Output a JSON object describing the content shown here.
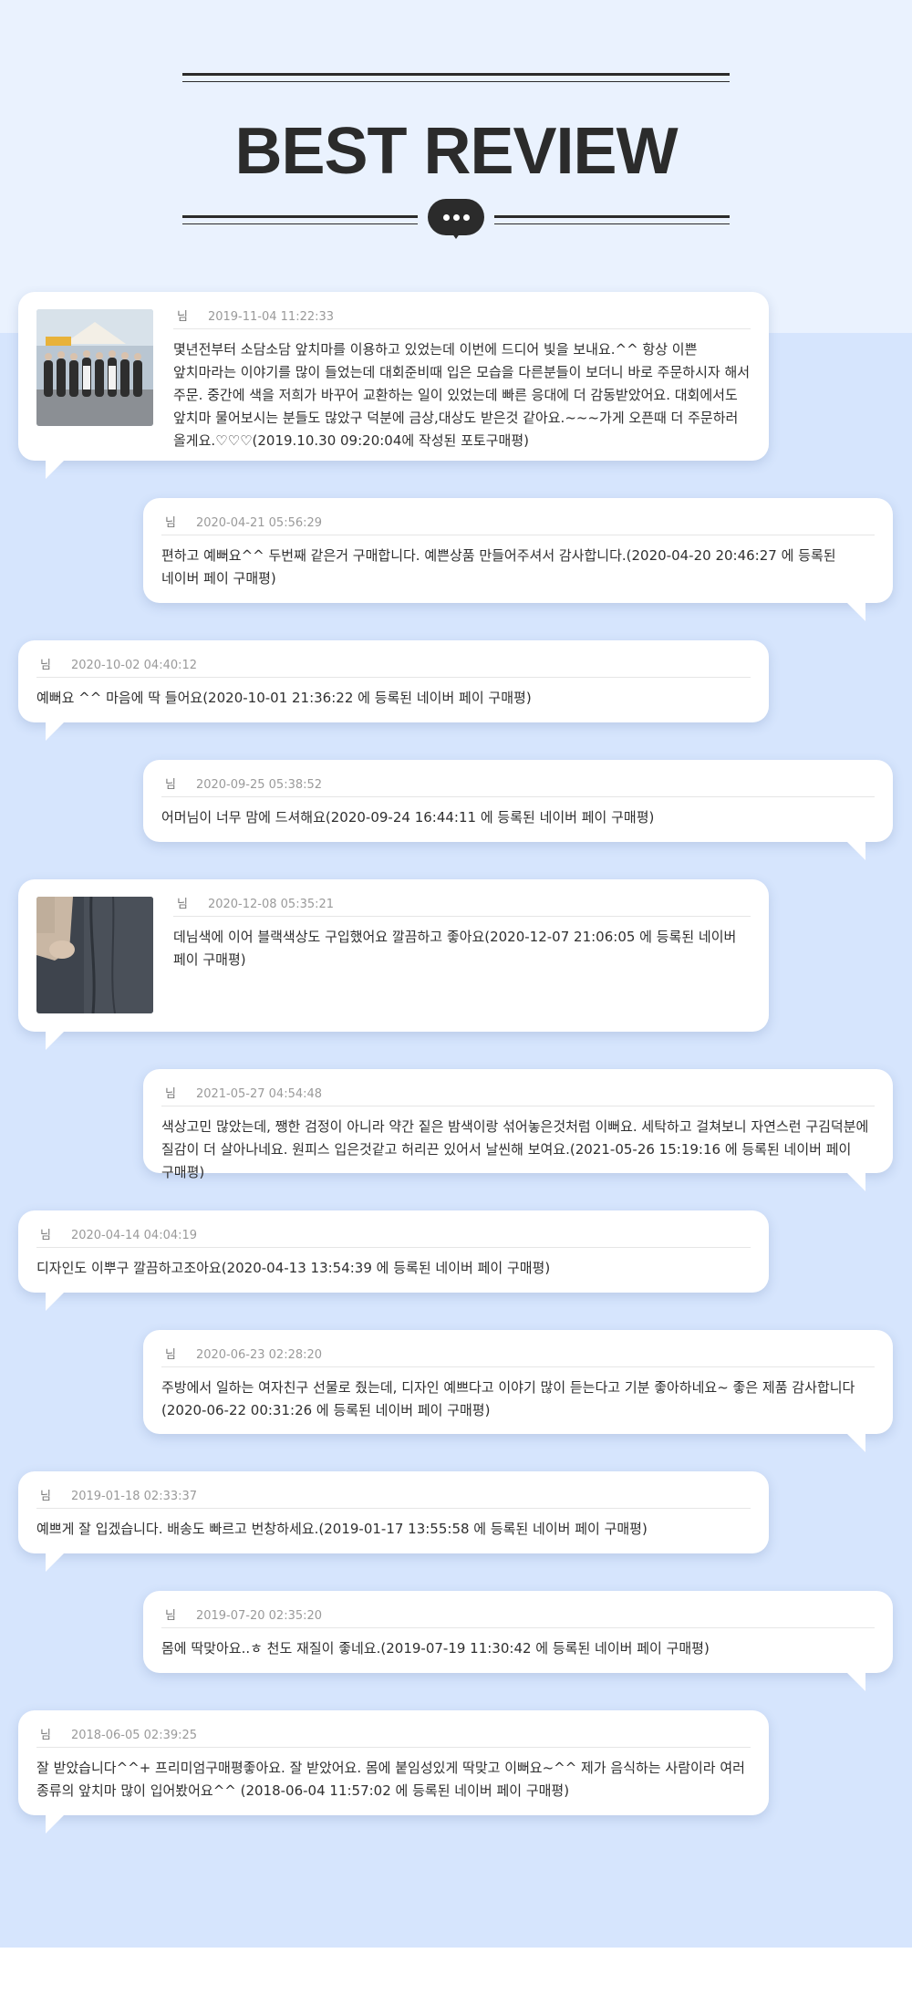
{
  "header": {
    "title": "BEST REVIEW"
  },
  "reviews": [
    {
      "name": "님",
      "date": "2019-11-04 11:22:33",
      "text": "몇년전부터 소담소담 앞치마를 이용하고 있었는데 이번에 드디어 빛을 보내요.^^ 항상 이쁜 앞치마라는 이야기를 많이 들었는데 대회준비때 입은 모습을 다른분들이 보더니 바로 주문하시자 해서 주문. 중간에 색을 저희가 바꾸어 교환하는 일이 있었는데 빠른 응대에 더 감동받았어요. 대회에서도 앞치마 물어보시는 분들도 많았구 덕분에 금상,대상도 받은것 같아요.~~~가게 오픈때 더 주문하러 올게요.♡♡♡(2019.10.30 09:20:04에 작성된 포토구매평)"
    },
    {
      "name": "님",
      "date": "2020-04-21 05:56:29",
      "text": "편하고 예뻐요^^ 두번째 같은거 구매합니다. 예쁜상품 만들어주셔서 감사합니다.(2020-04-20 20:46:27 에 등록된 네이버 페이 구매평)"
    },
    {
      "name": "님",
      "date": "2020-10-02 04:40:12",
      "text": "예뻐요 ^^ 마음에 딱 들어요(2020-10-01 21:36:22 에 등록된 네이버 페이 구매평)"
    },
    {
      "name": "님",
      "date": "2020-09-25 05:38:52",
      "text": "어머님이 너무 맘에 드셔해요(2020-09-24 16:44:11 에 등록된 네이버 페이 구매평)"
    },
    {
      "name": "님",
      "date": "2020-12-08 05:35:21",
      "text": "데님색에 이어 블랙색상도 구입했어요 깔끔하고 좋아요(2020-12-07 21:06:05 에 등록된 네이버 페이 구매평)"
    },
    {
      "name": "님",
      "date": "2021-05-27 04:54:48",
      "text": "색상고민 많았는데, 쨍한 검정이 아니라 약간 짙은 밤색이랑 섞어놓은것처럼 이뻐요. 세탁하고 걸쳐보니 자연스런 구김덕분에 질감이 더 살아나네요. 원피스 입은것같고 허리끈 있어서 날씬해 보여요.(2021-05-26 15:19:16 에 등록된 네이버 페이 구매평)"
    },
    {
      "name": "님",
      "date": "2020-04-14 04:04:19",
      "text": "디자인도 이뿌구 깔끔하고조아요(2020-04-13 13:54:39 에 등록된 네이버 페이 구매평)"
    },
    {
      "name": "님",
      "date": "2020-06-23 02:28:20",
      "text": "주방에서 일하는 여자친구 선물로 줬는데, 디자인 예쁘다고 이야기 많이 듣는다고 기분 좋아하네요~ 좋은 제품 감사합니다(2020-06-22 00:31:26 에 등록된 네이버 페이 구매평)"
    },
    {
      "name": "님",
      "date": "2019-01-18 02:33:37",
      "text": "예쁘게 잘 입겠습니다. 배송도 빠르고 번창하세요.(2019-01-17 13:55:58 에 등록된 네이버 페이 구매평)"
    },
    {
      "name": "님",
      "date": "2019-07-20 02:35:20",
      "text": "몸에 딱맞아요..ㅎ 천도 재질이 좋네요.(2019-07-19 11:30:42 에 등록된 네이버 페이 구매평)"
    },
    {
      "name": "님",
      "date": "2018-06-05 02:39:25",
      "text": "잘 받았습니다^^+ 프리미엄구매평좋아요. 잘 받았어요. 몸에 붙임성있게 딱맞고 이뻐요~^^ 제가 음식하는 사람이라 여러 종류의 앞치마 많이 입어봤어요^^ (2018-06-04 11:57:02 에 등록된 네이버 페이 구매평)"
    }
  ]
}
